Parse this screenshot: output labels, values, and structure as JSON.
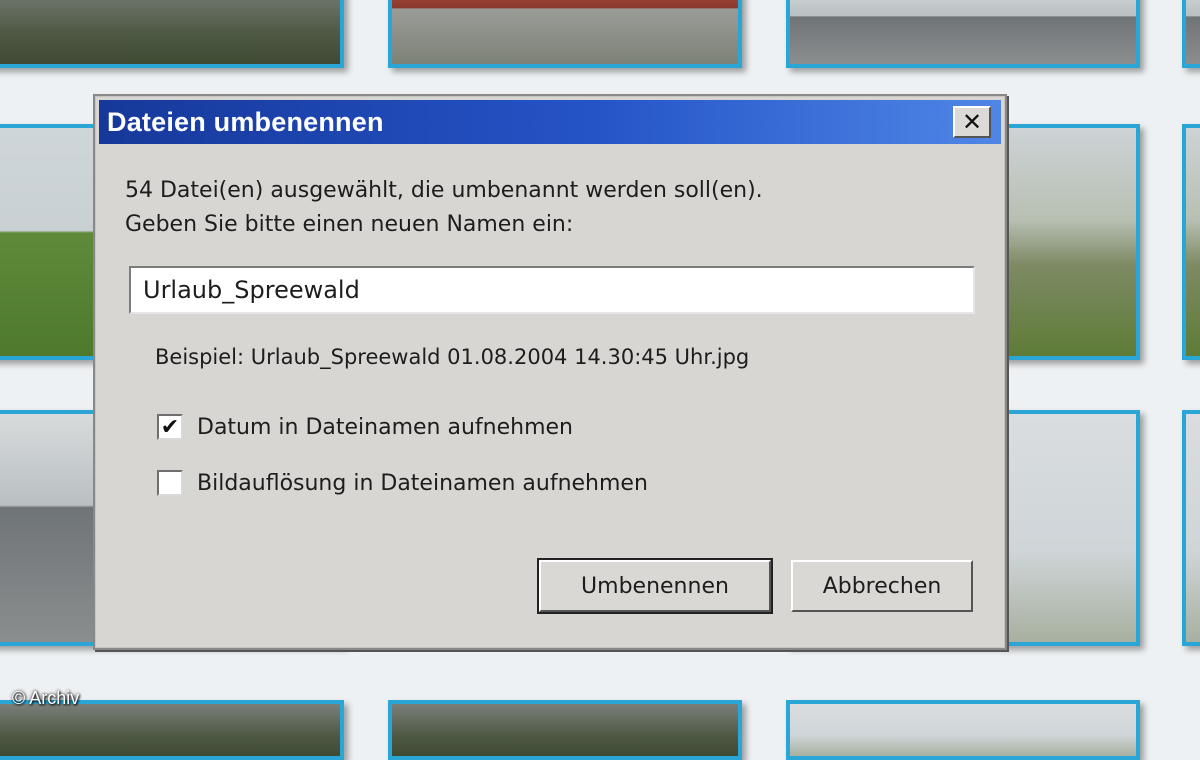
{
  "dialog": {
    "title": "Dateien umbenennen",
    "close_symbol": "✕",
    "info_line1": "54 Datei(en) ausgewählt, die umbenannt werden soll(en).",
    "info_line2": "Geben Sie bitte einen neuen Namen ein:",
    "name_value": "Urlaub_Spreewald",
    "example": "Beispiel: Urlaub_Spreewald 01.08.2004 14.30:45 Uhr.jpg",
    "checkbox_date": {
      "label": "Datum in Dateinamen aufnehmen",
      "checked": true,
      "mark": "✔"
    },
    "checkbox_resolution": {
      "label": "Bildauflösung in Dateinamen aufnehmen",
      "checked": false,
      "mark": ""
    },
    "rename_button": "Umbenennen",
    "cancel_button": "Abbrechen"
  },
  "copyright": "© Archiv",
  "colors": {
    "title_gradient_start": "#16389a",
    "title_gradient_end": "#4f86e6",
    "thumbnail_border": "#2aa6d6",
    "dialog_face": "#d8d6d3"
  },
  "icons": [
    "close-icon",
    "checkmark-icon"
  ]
}
